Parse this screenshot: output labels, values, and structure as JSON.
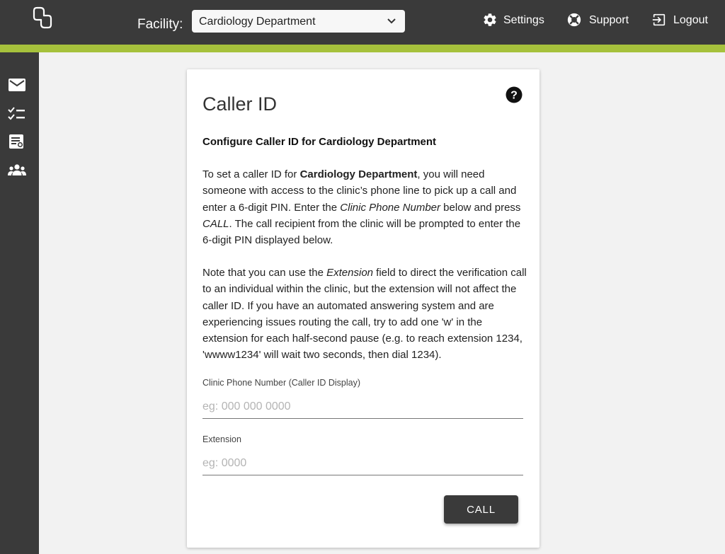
{
  "header": {
    "facility_label": "Facility:",
    "facility_selected": "Cardiology Department",
    "nav": {
      "settings": "Settings",
      "support": "Support",
      "logout": "Logout"
    }
  },
  "sidebar": {
    "items": [
      {
        "icon": "mail-icon"
      },
      {
        "icon": "checklist-icon"
      },
      {
        "icon": "report-icon"
      },
      {
        "icon": "group-icon"
      }
    ]
  },
  "card": {
    "title": "Caller ID",
    "subtitle": "Configure Caller ID for Cardiology Department",
    "para1": {
      "t1": "To set a caller ID for ",
      "b1": "Cardiology Department",
      "t2": ", you will need someone with access to the clinic’s phone line to pick up a call and enter a 6-digit PIN. Enter the ",
      "i1": "Clinic Phone Number",
      "t3": " below and press ",
      "i2": "CALL",
      "t4": ". The call recipient from the clinic will be prompted to enter the 6-digit PIN displayed below."
    },
    "para2": {
      "t1": "Note that you can use the ",
      "i1": "Extension",
      "t2": " field to direct the verification call to an individual within the clinic, but the extension will not affect the caller ID. If you have an automated answering system and are experiencing issues routing the call, try to add one 'w' in the extension for each half-second pause (e.g. to reach extension 1234, 'wwww1234' will wait two seconds, then dial 1234)."
    },
    "phone": {
      "label": "Clinic Phone Number (Caller ID Display)",
      "placeholder": "eg: 000 000 0000",
      "value": ""
    },
    "extension": {
      "label": "Extension",
      "placeholder": "eg: 0000",
      "value": ""
    },
    "call_button": "CALL"
  },
  "colors": {
    "topbar": "#3a3a3a",
    "accent": "#a6c13c",
    "background": "#f2f2f2"
  }
}
